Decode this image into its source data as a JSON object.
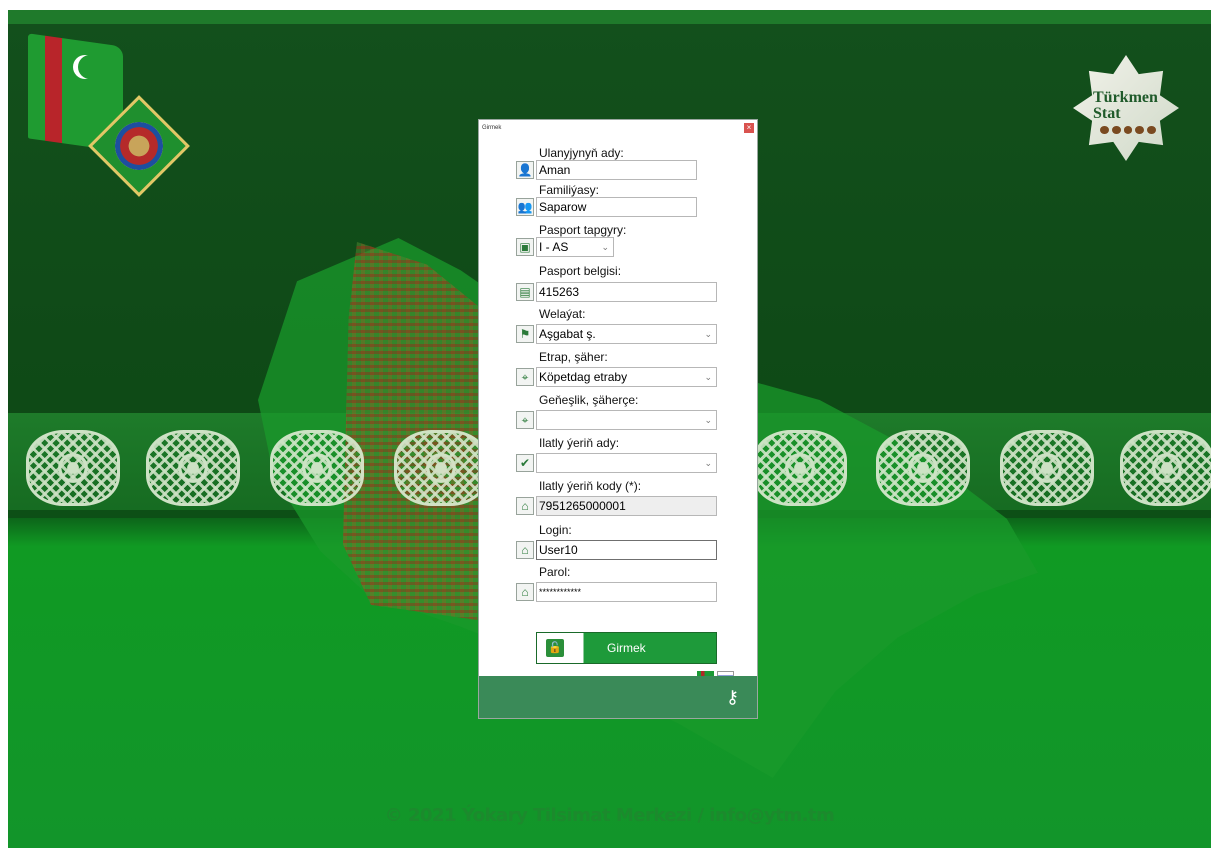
{
  "window": {
    "title": "Girmek",
    "close_glyph": "×"
  },
  "form": {
    "fields": [
      {
        "label": "Ulanyjynyň ady:",
        "value": "Aman",
        "icon": "user-icon"
      },
      {
        "label": "Familiýasy:",
        "value": "Saparow",
        "icon": "users-icon"
      },
      {
        "label": "Pasport tapgyry:",
        "value": "I - AS",
        "icon": "id-card-icon"
      },
      {
        "label": "Pasport belgisi:",
        "value": "415263",
        "icon": "passport-icon"
      },
      {
        "label": "Welaýat:",
        "value": "Aşgabat ş.",
        "icon": "flag-icon"
      },
      {
        "label": "Etrap, şäher:",
        "value": "Köpetdag etraby",
        "icon": "location-pin-icon"
      },
      {
        "label": "Geňeşlik, şäherçe:",
        "value": "",
        "icon": "location-pin-icon"
      },
      {
        "label": "Ilatly ýeriň ady:",
        "value": "",
        "icon": "checkmark-icon"
      },
      {
        "label": "Ilatly ýeriň kody (*):",
        "value": "7951265000001",
        "icon": "house-icon"
      },
      {
        "label": "Login:",
        "value": "User10",
        "icon": "house-icon"
      },
      {
        "label": "Parol:",
        "value": "************",
        "icon": "house-icon"
      }
    ],
    "submit_label": "Girmek"
  },
  "footer": {
    "copyright": "© 2021 Ýokary Tilsimat Merkezi /  info@ytm.tm"
  },
  "logo": {
    "text_line1": "Türkmen",
    "text_line2": "Stat"
  },
  "icons": {
    "user": "👤",
    "users": "👥",
    "id": "▣",
    "passport": "▤",
    "flag": "⚑",
    "pin": "⌖",
    "check": "✔",
    "house": "⌂",
    "lock": "🔓",
    "key": "⚷",
    "caret": "⌄"
  },
  "colors": {
    "accent_green": "#1e9a3a",
    "footer_green": "#3a8a58"
  }
}
